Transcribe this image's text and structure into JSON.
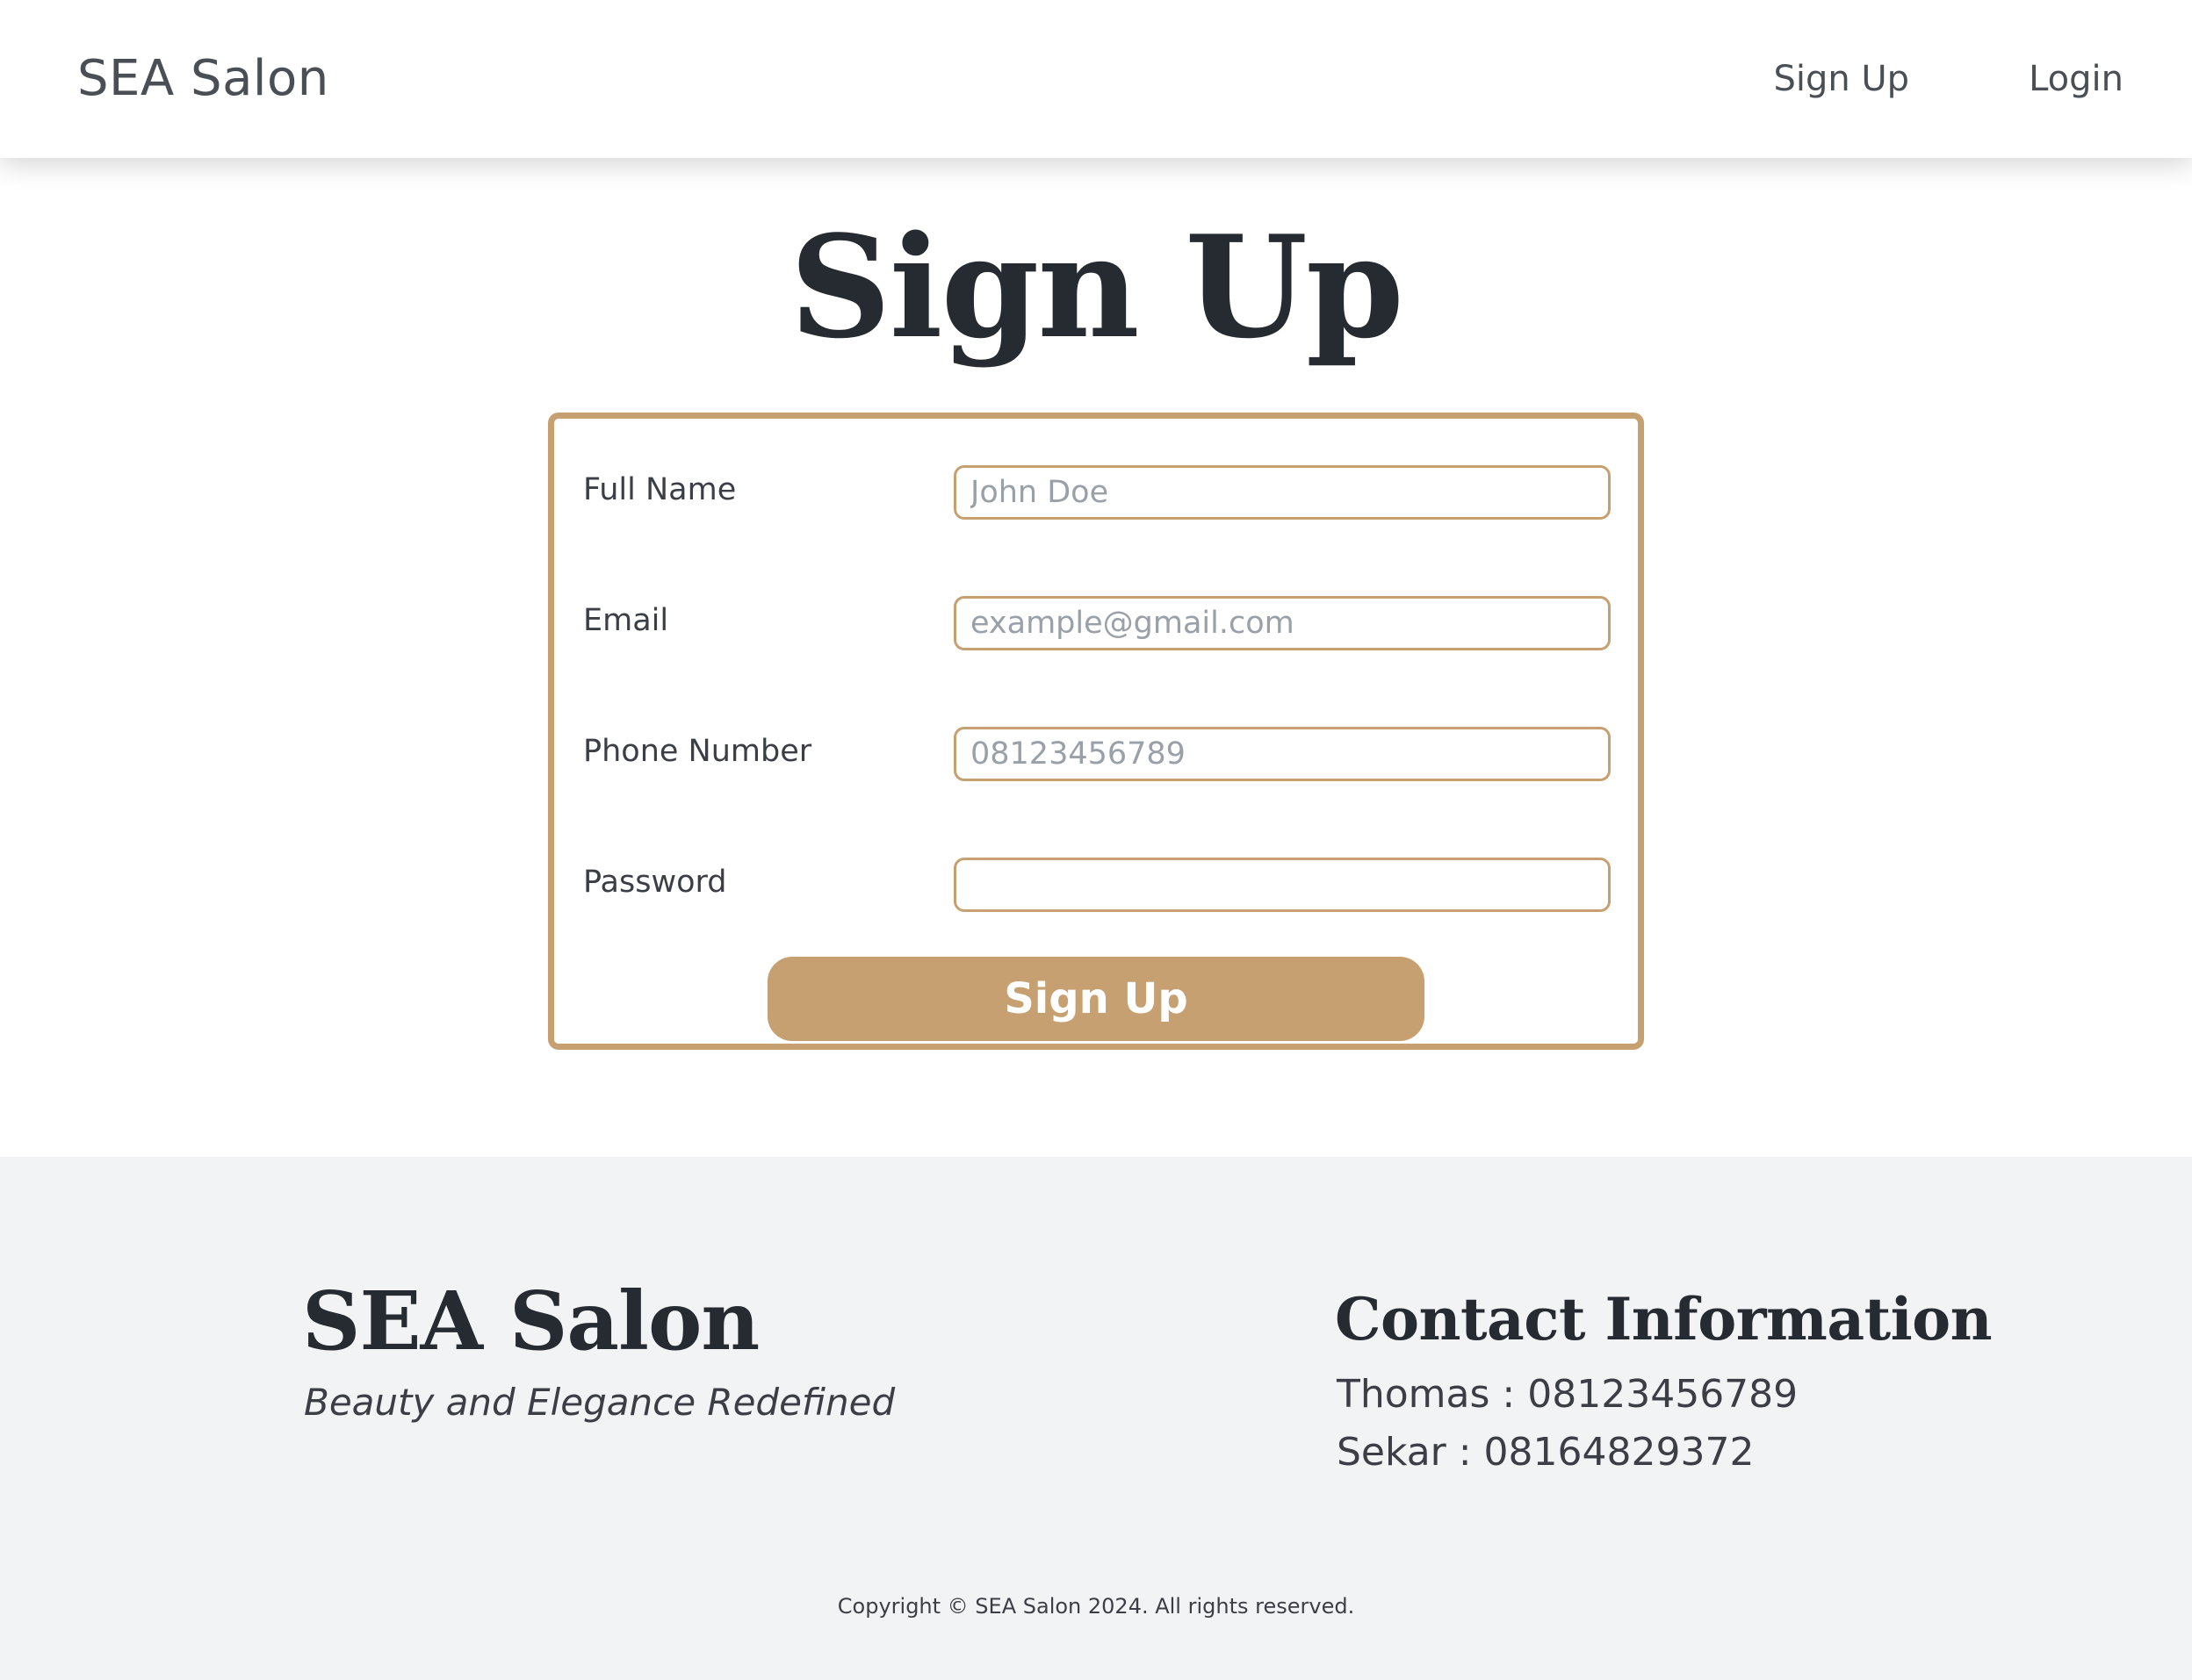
{
  "header": {
    "brand": "SEA Salon",
    "nav": [
      {
        "label": "Sign Up"
      },
      {
        "label": "Login"
      }
    ]
  },
  "main": {
    "title": "Sign Up",
    "form": {
      "fields": [
        {
          "label": "Full Name",
          "placeholder": "John Doe",
          "value": ""
        },
        {
          "label": "Email",
          "placeholder": "example@gmail.com",
          "value": ""
        },
        {
          "label": "Phone Number",
          "placeholder": "08123456789",
          "value": ""
        },
        {
          "label": "Password",
          "placeholder": "",
          "value": ""
        }
      ],
      "submit_label": "Sign Up"
    }
  },
  "footer": {
    "brand": "SEA Salon",
    "tagline": "Beauty and Elegance Redefined",
    "contact_heading": "Contact Information",
    "contacts": [
      {
        "text": "Thomas : 08123456789"
      },
      {
        "text": "Sekar : 08164829372"
      }
    ],
    "copyright": "Copyright © SEA Salon 2024. All rights reserved."
  },
  "colors": {
    "accent": "#c6a070",
    "heading": "#262a31",
    "text": "#3b3f45",
    "footer_bg": "#f2f3f5",
    "placeholder": "#9aa0a8"
  }
}
